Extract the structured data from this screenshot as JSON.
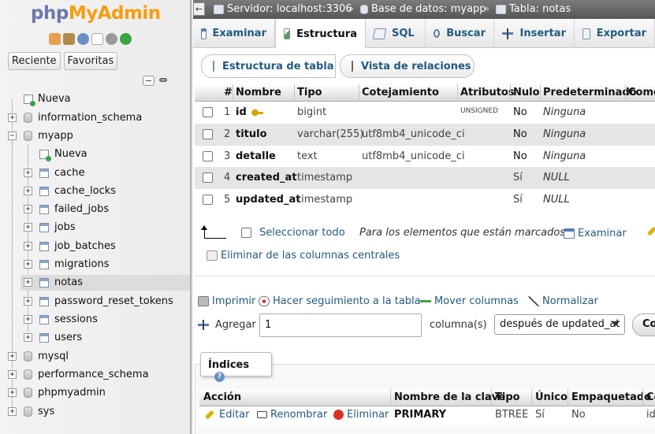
{
  "nav": {
    "logo_part1": "php",
    "logo_part2": "MyAdmin",
    "tabs": {
      "recent": "Reciente",
      "favorites": "Favoritas"
    },
    "tree": {
      "new": "Nueva",
      "information_schema": "information_schema",
      "myapp": "myapp",
      "myapp_new": "Nueva",
      "tables": [
        "cache",
        "cache_locks",
        "failed_jobs",
        "jobs",
        "job_batches",
        "migrations",
        "notas",
        "password_reset_tokens",
        "sessions",
        "users"
      ],
      "mysql": "mysql",
      "performance_schema": "performance_schema",
      "phpmyadmin": "phpmyadmin",
      "sys": "sys"
    }
  },
  "breadcrumb": {
    "server": "Servidor: localhost:3306",
    "database": "Base de datos: myapp",
    "table": "Tabla: notas",
    "sep": "»"
  },
  "tabs": {
    "examine": "Examinar",
    "structure": "Estructura",
    "sql": "SQL",
    "search": "Buscar",
    "insert": "Insertar",
    "export": "Exportar"
  },
  "subtabs": {
    "table_structure": "Estructura de tabla",
    "relations_view": "Vista de relaciones"
  },
  "columns_table": {
    "headers": {
      "num": "#",
      "name": "Nombre",
      "type": "Tipo",
      "collation": "Cotejamiento",
      "attributes": "Atributos",
      "null": "Nulo",
      "default": "Predeterminado",
      "comments": "Comentarios"
    },
    "rows": [
      {
        "num": "1",
        "name": "id",
        "type": "bigint",
        "collation": "",
        "attributes": "UNSIGNED",
        "null": "No",
        "default": "Ninguna"
      },
      {
        "num": "2",
        "name": "titulo",
        "type": "varchar(255)",
        "collation": "utf8mb4_unicode_ci",
        "attributes": "",
        "null": "No",
        "default": "Ninguna"
      },
      {
        "num": "3",
        "name": "detalle",
        "type": "text",
        "collation": "utf8mb4_unicode_ci",
        "attributes": "",
        "null": "No",
        "default": "Ninguna"
      },
      {
        "num": "4",
        "name": "created_at",
        "type": "timestamp",
        "collation": "",
        "attributes": "",
        "null": "Sí",
        "default": "NULL"
      },
      {
        "num": "5",
        "name": "updated_at",
        "type": "timestamp",
        "collation": "",
        "attributes": "",
        "null": "Sí",
        "default": "NULL"
      }
    ]
  },
  "bulk": {
    "select_all": "Seleccionar todo",
    "with_selected": "Para los elementos que están marcados:",
    "examine": "Examinar",
    "remove_central": "Eliminar de las columnas centrales"
  },
  "actions": {
    "print": "Imprimir",
    "track": "Hacer seguimiento a la tabla",
    "move_columns": "Mover columnas",
    "normalize": "Normalizar"
  },
  "add_columns": {
    "label": "Agregar",
    "count": "1",
    "unit": "columna(s)",
    "position": "después de updated_at",
    "go": "Continuar"
  },
  "indexes": {
    "legend": "Índices",
    "help": "?",
    "headers": {
      "action": "Acción",
      "key_name": "Nombre de la clave",
      "type": "Tipo",
      "unique": "Único",
      "packed": "Empaquetado",
      "column": "Columna"
    },
    "row": {
      "edit": "Editar",
      "rename": "Renombrar",
      "drop": "Eliminar",
      "key_name": "PRIMARY",
      "type": "BTREE",
      "unique": "Sí",
      "packed": "No",
      "column": "id"
    }
  }
}
